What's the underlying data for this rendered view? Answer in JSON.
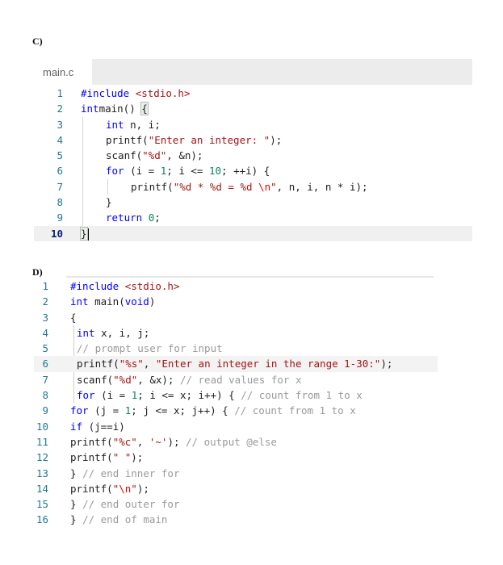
{
  "section_c": {
    "label": "C)",
    "tab": "main.c",
    "lines": [
      {
        "num": "1",
        "tokens": [
          [
            "pp",
            "#include "
          ],
          [
            "s",
            "<stdio.h>"
          ]
        ]
      },
      {
        "num": "2",
        "tokens": [
          [
            "k",
            "int"
          ],
          [
            "",
            "main() "
          ],
          [
            "brace",
            "{"
          ]
        ]
      },
      {
        "num": "3",
        "indent": 1,
        "tokens": [
          [
            "k",
            "int"
          ],
          [
            "",
            " n, i;"
          ]
        ]
      },
      {
        "num": "4",
        "indent": 1,
        "tokens": [
          [
            "",
            "printf("
          ],
          [
            "s",
            "\"Enter an integer: \""
          ],
          [
            "",
            ");"
          ]
        ]
      },
      {
        "num": "5",
        "indent": 1,
        "tokens": [
          [
            "",
            "scanf("
          ],
          [
            "s",
            "\"%d\""
          ],
          [
            "",
            ", &n);"
          ]
        ]
      },
      {
        "num": "6",
        "indent": 1,
        "tokens": [
          [
            "k",
            "for"
          ],
          [
            "",
            " (i = "
          ],
          [
            "n",
            "1"
          ],
          [
            "",
            "; i <= "
          ],
          [
            "n",
            "10"
          ],
          [
            "",
            "; ++i) {"
          ]
        ]
      },
      {
        "num": "7",
        "indent": 2,
        "tokens": [
          [
            "",
            "printf("
          ],
          [
            "s",
            "\"%d * %d = %d "
          ],
          [
            "esc",
            "\\n"
          ],
          [
            "s",
            "\""
          ],
          [
            "",
            ", n, i, n * i);"
          ]
        ]
      },
      {
        "num": "8",
        "indent": 1,
        "tokens": [
          [
            "",
            "}"
          ]
        ]
      },
      {
        "num": "9",
        "indent": 1,
        "tokens": [
          [
            "k",
            "return"
          ],
          [
            "",
            " "
          ],
          [
            "n",
            "0"
          ],
          [
            "",
            ";"
          ]
        ]
      },
      {
        "num": "10",
        "active": true,
        "tokens": [
          [
            "brace",
            "}"
          ],
          [
            "cursor",
            ""
          ]
        ]
      }
    ]
  },
  "section_d": {
    "label": "D)",
    "lines": [
      {
        "num": "1",
        "tokens": [
          [
            "pp",
            "#include "
          ],
          [
            "s",
            "<stdio.h>"
          ]
        ]
      },
      {
        "num": "2",
        "tokens": [
          [
            "k",
            "int"
          ],
          [
            "",
            " main("
          ],
          [
            "k",
            "void"
          ],
          [
            "",
            ")"
          ]
        ]
      },
      {
        "num": "3",
        "tokens": [
          [
            "",
            "{"
          ]
        ]
      },
      {
        "num": "4",
        "pad": 1,
        "tokens": [
          [
            "k",
            "int"
          ],
          [
            "",
            " x, i, j;"
          ]
        ]
      },
      {
        "num": "5",
        "pad": 1,
        "tokens": [
          [
            "cm",
            "// prompt user for input"
          ]
        ]
      },
      {
        "num": "6",
        "pad": 1,
        "active": true,
        "tokens": [
          [
            "",
            "printf("
          ],
          [
            "s",
            "\"%s\""
          ],
          [
            "",
            ", "
          ],
          [
            "s",
            "\"Enter an integer in the range 1-30:\""
          ],
          [
            "",
            ");"
          ]
        ]
      },
      {
        "num": "7",
        "pad": 1,
        "tokens": [
          [
            "",
            "scanf("
          ],
          [
            "s",
            "\"%d\""
          ],
          [
            "",
            ", &x); "
          ],
          [
            "cm",
            "// read values for x"
          ]
        ]
      },
      {
        "num": "8",
        "pad": 1,
        "tokens": [
          [
            "k",
            "for"
          ],
          [
            "",
            " (i = "
          ],
          [
            "n",
            "1"
          ],
          [
            "",
            "; i <= x; i++) { "
          ],
          [
            "cm",
            "// count from 1 to x"
          ]
        ]
      },
      {
        "num": "9",
        "tokens": [
          [
            "k",
            "for"
          ],
          [
            "",
            " (j = "
          ],
          [
            "n",
            "1"
          ],
          [
            "",
            "; j <= x; j++) { "
          ],
          [
            "cm",
            "// count from 1 to x"
          ]
        ]
      },
      {
        "num": "10",
        "tokens": [
          [
            "k",
            "if"
          ],
          [
            "",
            " (j==i)"
          ]
        ]
      },
      {
        "num": "11",
        "tokens": [
          [
            "",
            "printf("
          ],
          [
            "s",
            "\"%c\""
          ],
          [
            "",
            ", "
          ],
          [
            "s",
            "'~'"
          ],
          [
            "",
            "); "
          ],
          [
            "cm",
            "// output @else"
          ]
        ]
      },
      {
        "num": "12",
        "tokens": [
          [
            "",
            "printf("
          ],
          [
            "s",
            "\" \""
          ],
          [
            "",
            ");"
          ]
        ]
      },
      {
        "num": "13",
        "tokens": [
          [
            "",
            "} "
          ],
          [
            "cm",
            "// end inner for"
          ]
        ]
      },
      {
        "num": "14",
        "tokens": [
          [
            "",
            "printf("
          ],
          [
            "s",
            "\""
          ],
          [
            "esc",
            "\\n"
          ],
          [
            "s",
            "\""
          ],
          [
            "",
            ");"
          ]
        ]
      },
      {
        "num": "15",
        "tokens": [
          [
            "",
            "} "
          ],
          [
            "cm",
            "// end outer for"
          ]
        ]
      },
      {
        "num": "16",
        "tokens": [
          [
            "",
            "} "
          ],
          [
            "cm",
            "// end of main"
          ]
        ]
      }
    ]
  }
}
